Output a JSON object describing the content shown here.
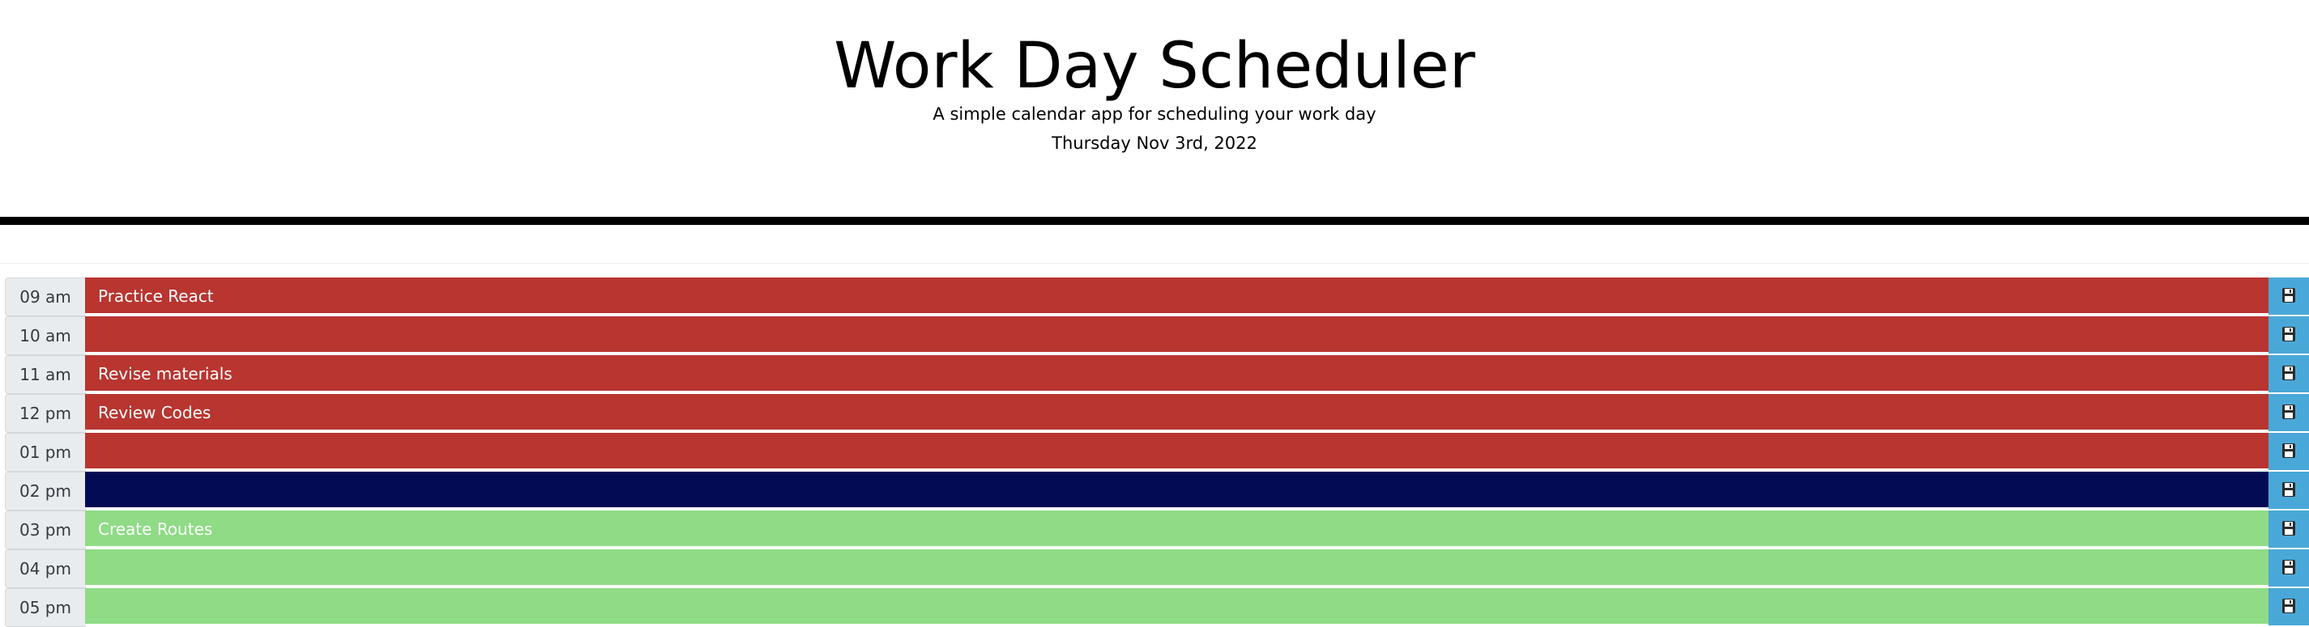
{
  "header": {
    "title": "Work Day Scheduler",
    "subtitle": "A simple calendar app for scheduling your work day",
    "current_day": "Thursday Nov 3rd, 2022"
  },
  "colors": {
    "past": "#b83530",
    "present": "#040b55",
    "future": "#8fdb86",
    "save": "#4aa8d8",
    "hour_bg": "#e9ecef"
  },
  "time_blocks": [
    {
      "hour": "09 am",
      "text": "Practice React",
      "state": "past"
    },
    {
      "hour": "10 am",
      "text": "",
      "state": "past"
    },
    {
      "hour": "11 am",
      "text": "Revise materials",
      "state": "past"
    },
    {
      "hour": "12 pm",
      "text": "Review Codes",
      "state": "past"
    },
    {
      "hour": "01 pm",
      "text": "",
      "state": "past"
    },
    {
      "hour": "02 pm",
      "text": "",
      "state": "present"
    },
    {
      "hour": "03 pm",
      "text": "Create Routes",
      "state": "future"
    },
    {
      "hour": "04 pm",
      "text": "",
      "state": "future"
    },
    {
      "hour": "05 pm",
      "text": "",
      "state": "future"
    }
  ],
  "save_icon": "floppy-disk-icon"
}
